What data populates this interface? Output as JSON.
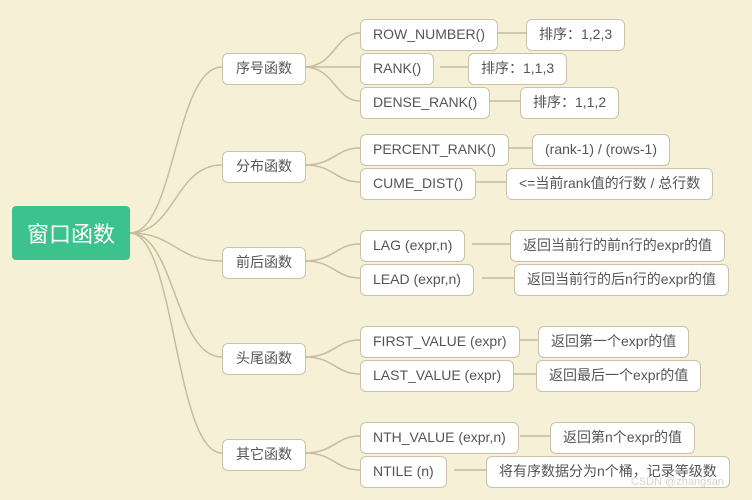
{
  "root": "窗口函数",
  "cats": {
    "seq": {
      "label": "序号函数"
    },
    "dist": {
      "label": "分布函数"
    },
    "around": {
      "label": "前后函数"
    },
    "ends": {
      "label": "头尾函数"
    },
    "other": {
      "label": "其它函数"
    }
  },
  "fn": {
    "rownum": "ROW_NUMBER()",
    "rank": "RANK()",
    "dense": "DENSE_RANK()",
    "prank": "PERCENT_RANK()",
    "cume": "CUME_DIST()",
    "lag": "LAG (expr,n)",
    "lead": "LEAD (expr,n)",
    "first": "FIRST_VALUE (expr)",
    "last": "LAST_VALUE (expr)",
    "nth": "NTH_VALUE (expr,n)",
    "ntile": "NTILE (n)"
  },
  "desc": {
    "rownum": "排序：1,2,3",
    "rank": "排序：1,1,3",
    "dense": "排序：1,1,2",
    "prank": "(rank-1) / (rows-1)",
    "cume": "<=当前rank值的行数 / 总行数",
    "lag": "返回当前行的前n行的expr的值",
    "lead": "返回当前行的后n行的expr的值",
    "first": "返回第一个expr的值",
    "last": "返回最后一个expr的值",
    "nth": "返回第n个expr的值",
    "ntile": "将有序数据分为n个桶，记录等级数"
  },
  "watermark": "CSDN @zhangsan"
}
